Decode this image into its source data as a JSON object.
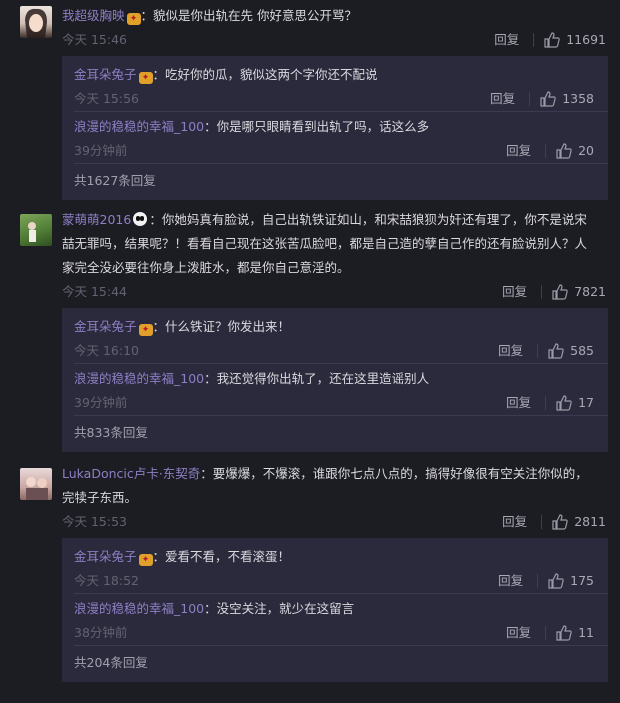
{
  "comments": [
    {
      "user": "我超级胸映",
      "badge": "vip",
      "text": "：貌似是你出轨在先  你好意思公开骂？",
      "time": "今天 15:46",
      "reply_label": "回复",
      "likes": "11691",
      "replies": [
        {
          "user": "金耳朵兔子",
          "badge": "vip",
          "text": "：吃好你的瓜，貌似这两个字你还不配说",
          "time": "今天 15:56",
          "reply_label": "回复",
          "likes": "1358"
        },
        {
          "user": "浪漫的稳稳的幸福_100",
          "text": "：你是哪只眼睛看到出轨了吗，话这么多",
          "time": "39分钟前",
          "reply_label": "回复",
          "likes": "20"
        }
      ],
      "more": "共1627条回复"
    },
    {
      "user": "蒙萌萌2016",
      "text_a": "：你她妈真有脸说，自己出轨铁证如山，和宋喆狼狈为奸还有理了，你不是说宋",
      "text_b": "喆无罪吗，结果呢？！看看自己现在这张苦瓜脸吧，都是自己造的孽自己作的还有脸说别人？人",
      "text_c": "家完全没必要往你身上泼脏水，都是你自己意淫的。",
      "time": "今天 15:44",
      "reply_label": "回复",
      "likes": "7821",
      "replies": [
        {
          "user": "金耳朵兔子",
          "badge": "vip",
          "text": "：什么铁证？你发出来！",
          "time": "今天 16:10",
          "reply_label": "回复",
          "likes": "585"
        },
        {
          "user": "浪漫的稳稳的幸福_100",
          "text": "：我还觉得你出轨了，还在这里造谣别人",
          "time": "39分钟前",
          "reply_label": "回复",
          "likes": "17"
        }
      ],
      "more": "共833条回复"
    },
    {
      "user": "LukaDoncic卢卡·东契奇",
      "text_a": "：要爆爆，不爆滚，谁跟你七点八点的，搞得好像很有空关注你似的，",
      "text_b": "完犊子东西。",
      "time": "今天 15:53",
      "reply_label": "回复",
      "likes": "2811",
      "replies": [
        {
          "user": "金耳朵兔子",
          "badge": "vip",
          "text": "：爱看不看，不看滚蛋！",
          "time": "今天 18:52",
          "reply_label": "回复",
          "likes": "175"
        },
        {
          "user": "浪漫的稳稳的幸福_100",
          "text": "：没空关注，就少在这留言",
          "time": "38分钟前",
          "reply_label": "回复",
          "likes": "11"
        }
      ],
      "more": "共204条回复"
    }
  ]
}
